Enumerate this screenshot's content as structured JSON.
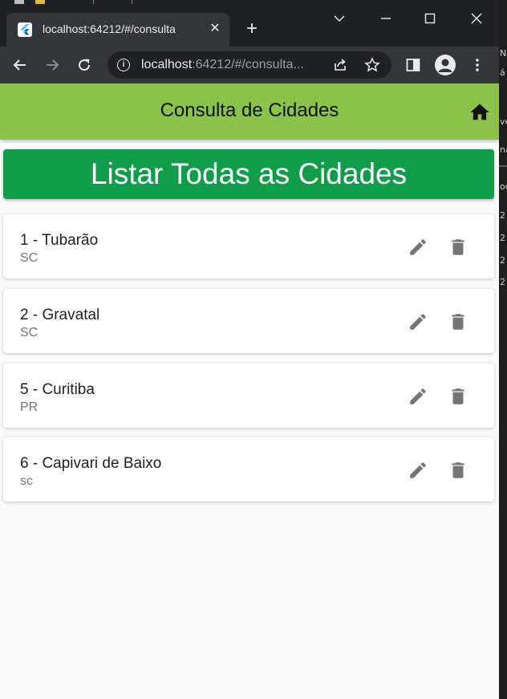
{
  "browser": {
    "tab_title": "localhost:64212/#/consulta",
    "url_host": "localhost",
    "url_path": ":64212/#/consulta..."
  },
  "icons": {
    "back": "arrow-left-icon",
    "forward": "arrow-right-icon",
    "reload": "reload-icon",
    "info": "info-icon",
    "share": "share-icon",
    "bookmark": "star-icon",
    "side_panel": "side-panel-icon",
    "profile": "profile-icon",
    "menu": "kebab-menu-icon",
    "home": "home-icon",
    "edit": "pencil-icon",
    "delete": "trash-icon"
  },
  "colors": {
    "appbar": "#8bc34a",
    "primary_button": "#0f9d49",
    "icon_grey": "#757575"
  },
  "app": {
    "title": "Consulta de Cidades",
    "list_all_button": "Listar Todas as Cidades",
    "cities": [
      {
        "title": "1 - Tubarão",
        "state": "SC"
      },
      {
        "title": "2 - Gravatal",
        "state": "SC"
      },
      {
        "title": "5 - Curitiba",
        "state": "PR"
      },
      {
        "title": "6 - Capivari de Baixo",
        "state": "sc"
      }
    ]
  },
  "side_window": {
    "fragments": [
      "No",
      "á",
      "ve",
      "na",
      "oc",
      "2",
      "2",
      "2",
      "2"
    ]
  }
}
